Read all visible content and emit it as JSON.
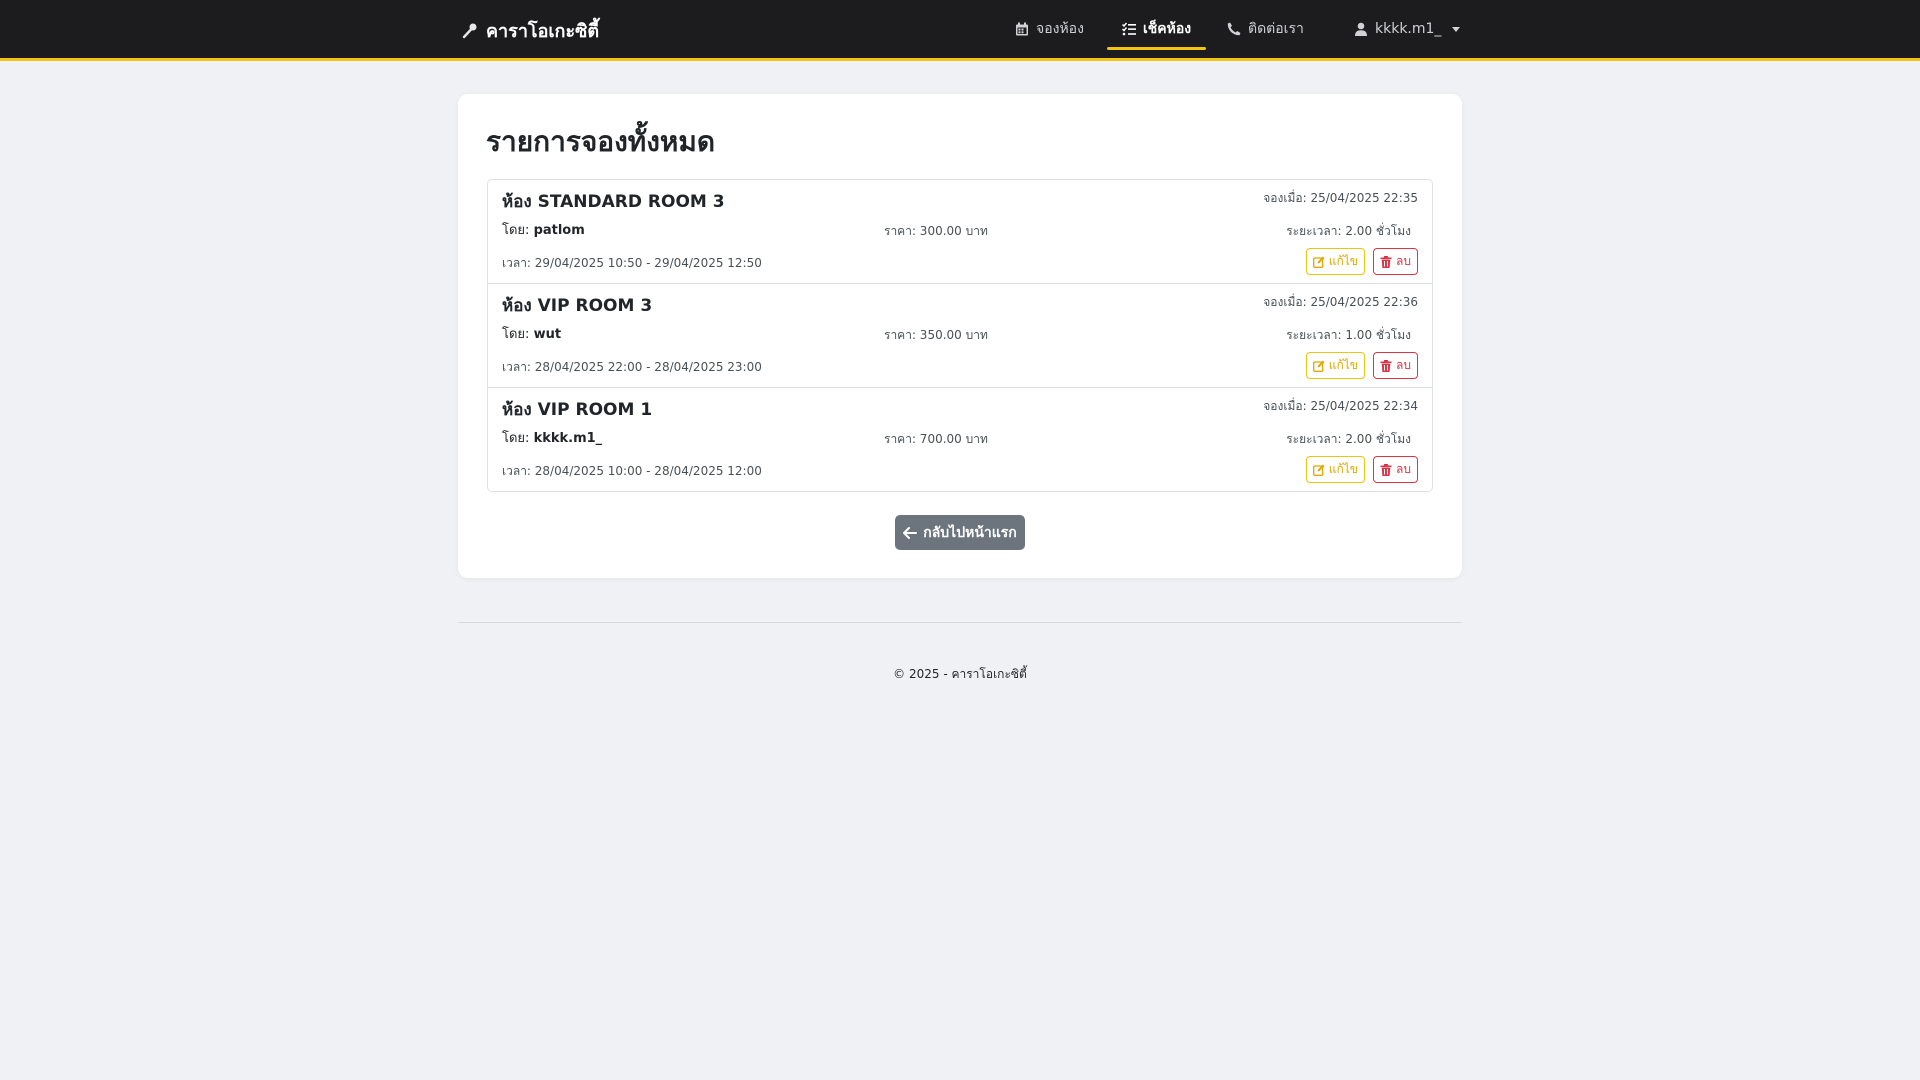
{
  "nav": {
    "brand": "คาราโอเกะซิตี้",
    "items": [
      {
        "label": "จองห้อง",
        "icon": "calendar-icon"
      },
      {
        "label": "เช็คห้อง",
        "icon": "list-check-icon"
      },
      {
        "label": "ติดต่อเรา",
        "icon": "phone-icon"
      }
    ],
    "user": "kkkk.m1_",
    "accent": "#f2c311"
  },
  "page": {
    "title": "รายการจองทั้งหมด",
    "back_label": "กลับไปหน้าแรก"
  },
  "bookings": [
    {
      "room": "ห้อง STANDARD ROOM 3",
      "booked_at": "จองเมื่อ: 25/04/2025 22:35",
      "by_label": "โดย:",
      "by_user": "patlom",
      "price": "ราคา: 300.00 บาท",
      "duration": "ระยะเวลา: 2.00 ชั่วโมง",
      "time": "เวลา: 29/04/2025 10:50 - 29/04/2025 12:50",
      "edit_label": "แก้ไข",
      "delete_label": "ลบ"
    },
    {
      "room": "ห้อง VIP ROOM 3",
      "booked_at": "จองเมื่อ: 25/04/2025 22:36",
      "by_label": "โดย:",
      "by_user": "wut",
      "price": "ราคา: 350.00 บาท",
      "duration": "ระยะเวลา: 1.00 ชั่วโมง",
      "time": "เวลา: 28/04/2025 22:00 - 28/04/2025 23:00",
      "edit_label": "แก้ไข",
      "delete_label": "ลบ"
    },
    {
      "room": "ห้อง VIP ROOM 1",
      "booked_at": "จองเมื่อ: 25/04/2025 22:34",
      "by_label": "โดย:",
      "by_user": "kkkk.m1_",
      "price": "ราคา: 700.00 บาท",
      "duration": "ระยะเวลา: 2.00 ชั่วโมง",
      "time": "เวลา: 28/04/2025 10:00 - 28/04/2025 12:00",
      "edit_label": "แก้ไข",
      "delete_label": "ลบ"
    }
  ],
  "footer": {
    "text": "© 2025 - คาราโอเกะซิตี้"
  }
}
